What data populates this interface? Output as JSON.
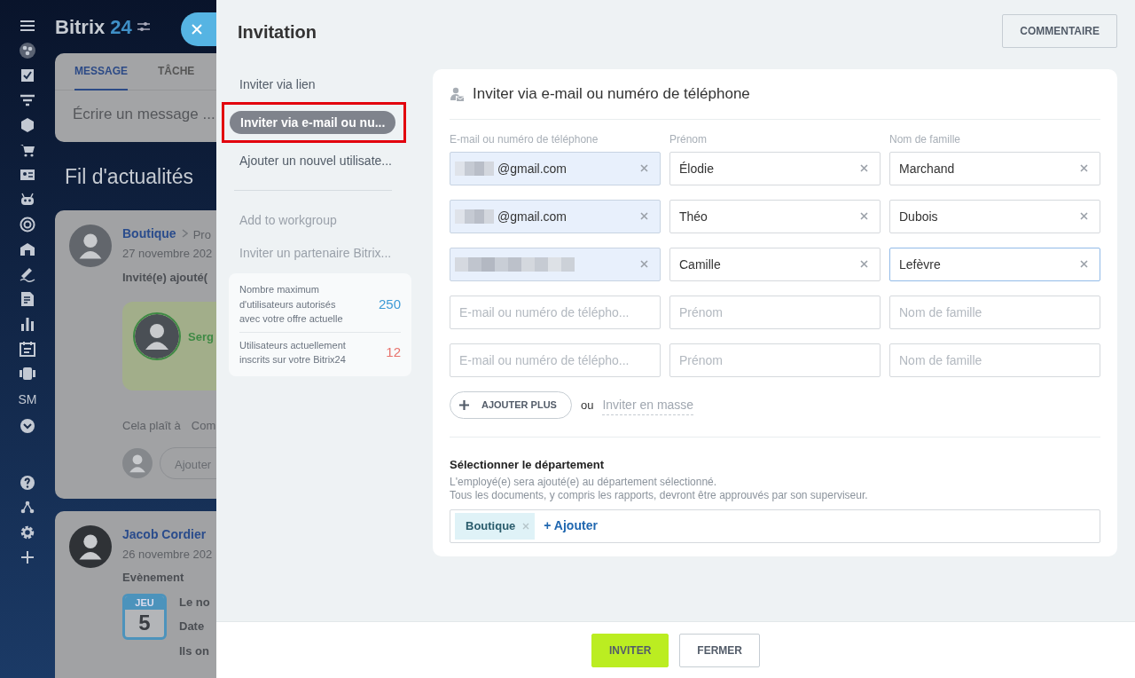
{
  "app": {
    "logo_name": "Bitrix",
    "logo_number": "24"
  },
  "sidebar": {
    "text_item": "SM"
  },
  "composer": {
    "tabs": [
      {
        "label": "MESSAGE",
        "selected": true
      },
      {
        "label": "TÂCHE",
        "selected": false
      }
    ],
    "placeholder": "Écrire un message ..."
  },
  "feed": {
    "title": "Fil d'actualités",
    "posts": [
      {
        "kind": "invite",
        "author": "Boutique",
        "crumb": "Pro",
        "date": "27 novembre 202",
        "heading": "Invité(e) ajouté(",
        "user_name": "Serg",
        "actions": [
          "Cela plaît à",
          "Com"
        ],
        "comment_placeholder": "Ajouter"
      },
      {
        "kind": "event",
        "author": "Jacob Cordier",
        "date": "26 novembre 202",
        "heading": "Evènement",
        "calendar": {
          "weekday": "JEU",
          "day": "5"
        },
        "lines": [
          "Le no",
          "Date",
          "Ils on"
        ]
      }
    ]
  },
  "invitation": {
    "title": "Invitation",
    "comment_button": "COMMENTAIRE",
    "menu": [
      {
        "label": "Inviter via lien",
        "selected": false,
        "highlighted": false
      },
      {
        "label": "Inviter via e-mail ou nu...",
        "selected": true,
        "highlighted": true
      },
      {
        "label": "Ajouter un nouvel utilisate...",
        "selected": false,
        "highlighted": false
      }
    ],
    "extra_menu": [
      {
        "label": "Add to workgroup",
        "disabled": true
      },
      {
        "label": "Inviter un partenaire Bitrix...",
        "disabled": true
      }
    ],
    "stats": [
      {
        "label": "Nombre maximum d'utilisateurs autorisés avec votre offre actuelle",
        "value": "250",
        "color": "#3d9bd6"
      },
      {
        "label": "Utilisateurs actuellement inscrits sur votre Bitrix24",
        "value": "12",
        "color": "#e8726c"
      }
    ],
    "form": {
      "title": "Inviter via e-mail ou numéro de téléphone",
      "columns": [
        "E-mail ou numéro de téléphone",
        "Prénom",
        "Nom de famille"
      ],
      "rows": [
        [
          {
            "value": "@gmail.com",
            "redacted": true,
            "focused": false
          },
          {
            "value": "Élodie",
            "focused": false
          },
          {
            "value": "Marchand",
            "focused": false
          }
        ],
        [
          {
            "value": "@gmail.com",
            "redacted": true,
            "focused": false
          },
          {
            "value": "Théo",
            "focused": false
          },
          {
            "value": "Dubois",
            "focused": false
          }
        ],
        [
          {
            "redacted": true,
            "focused": false
          },
          {
            "value": "Camille",
            "focused": false
          },
          {
            "value": "Lefèvre",
            "focused": true
          }
        ],
        [
          {
            "placeholder": "E-mail ou numéro de télépho...",
            "focused": false
          },
          {
            "placeholder": "Prénom",
            "focused": false
          },
          {
            "placeholder": "Nom de famille",
            "focused": false
          }
        ],
        [
          {
            "placeholder": "E-mail ou numéro de télépho...",
            "focused": false
          },
          {
            "placeholder": "Prénom",
            "focused": false
          },
          {
            "placeholder": "Nom de famille",
            "focused": false
          }
        ]
      ],
      "add_more_button": "AJOUTER PLUS",
      "or_text": "ou",
      "mass_invite_link": "Inviter en masse"
    },
    "department": {
      "title": "Sélectionner le département",
      "hint_lines": [
        "L'employé(e) sera ajouté(e) au département sélectionné.",
        "Tous les documents, y compris les rapports, devront être approuvés par son superviseur."
      ],
      "tags": [
        "Boutique"
      ],
      "add_link": "+ Ajouter"
    },
    "footer_buttons": [
      {
        "label": "INVITER",
        "kind": "primary"
      },
      {
        "label": "FERMER",
        "kind": "secondary"
      }
    ]
  }
}
